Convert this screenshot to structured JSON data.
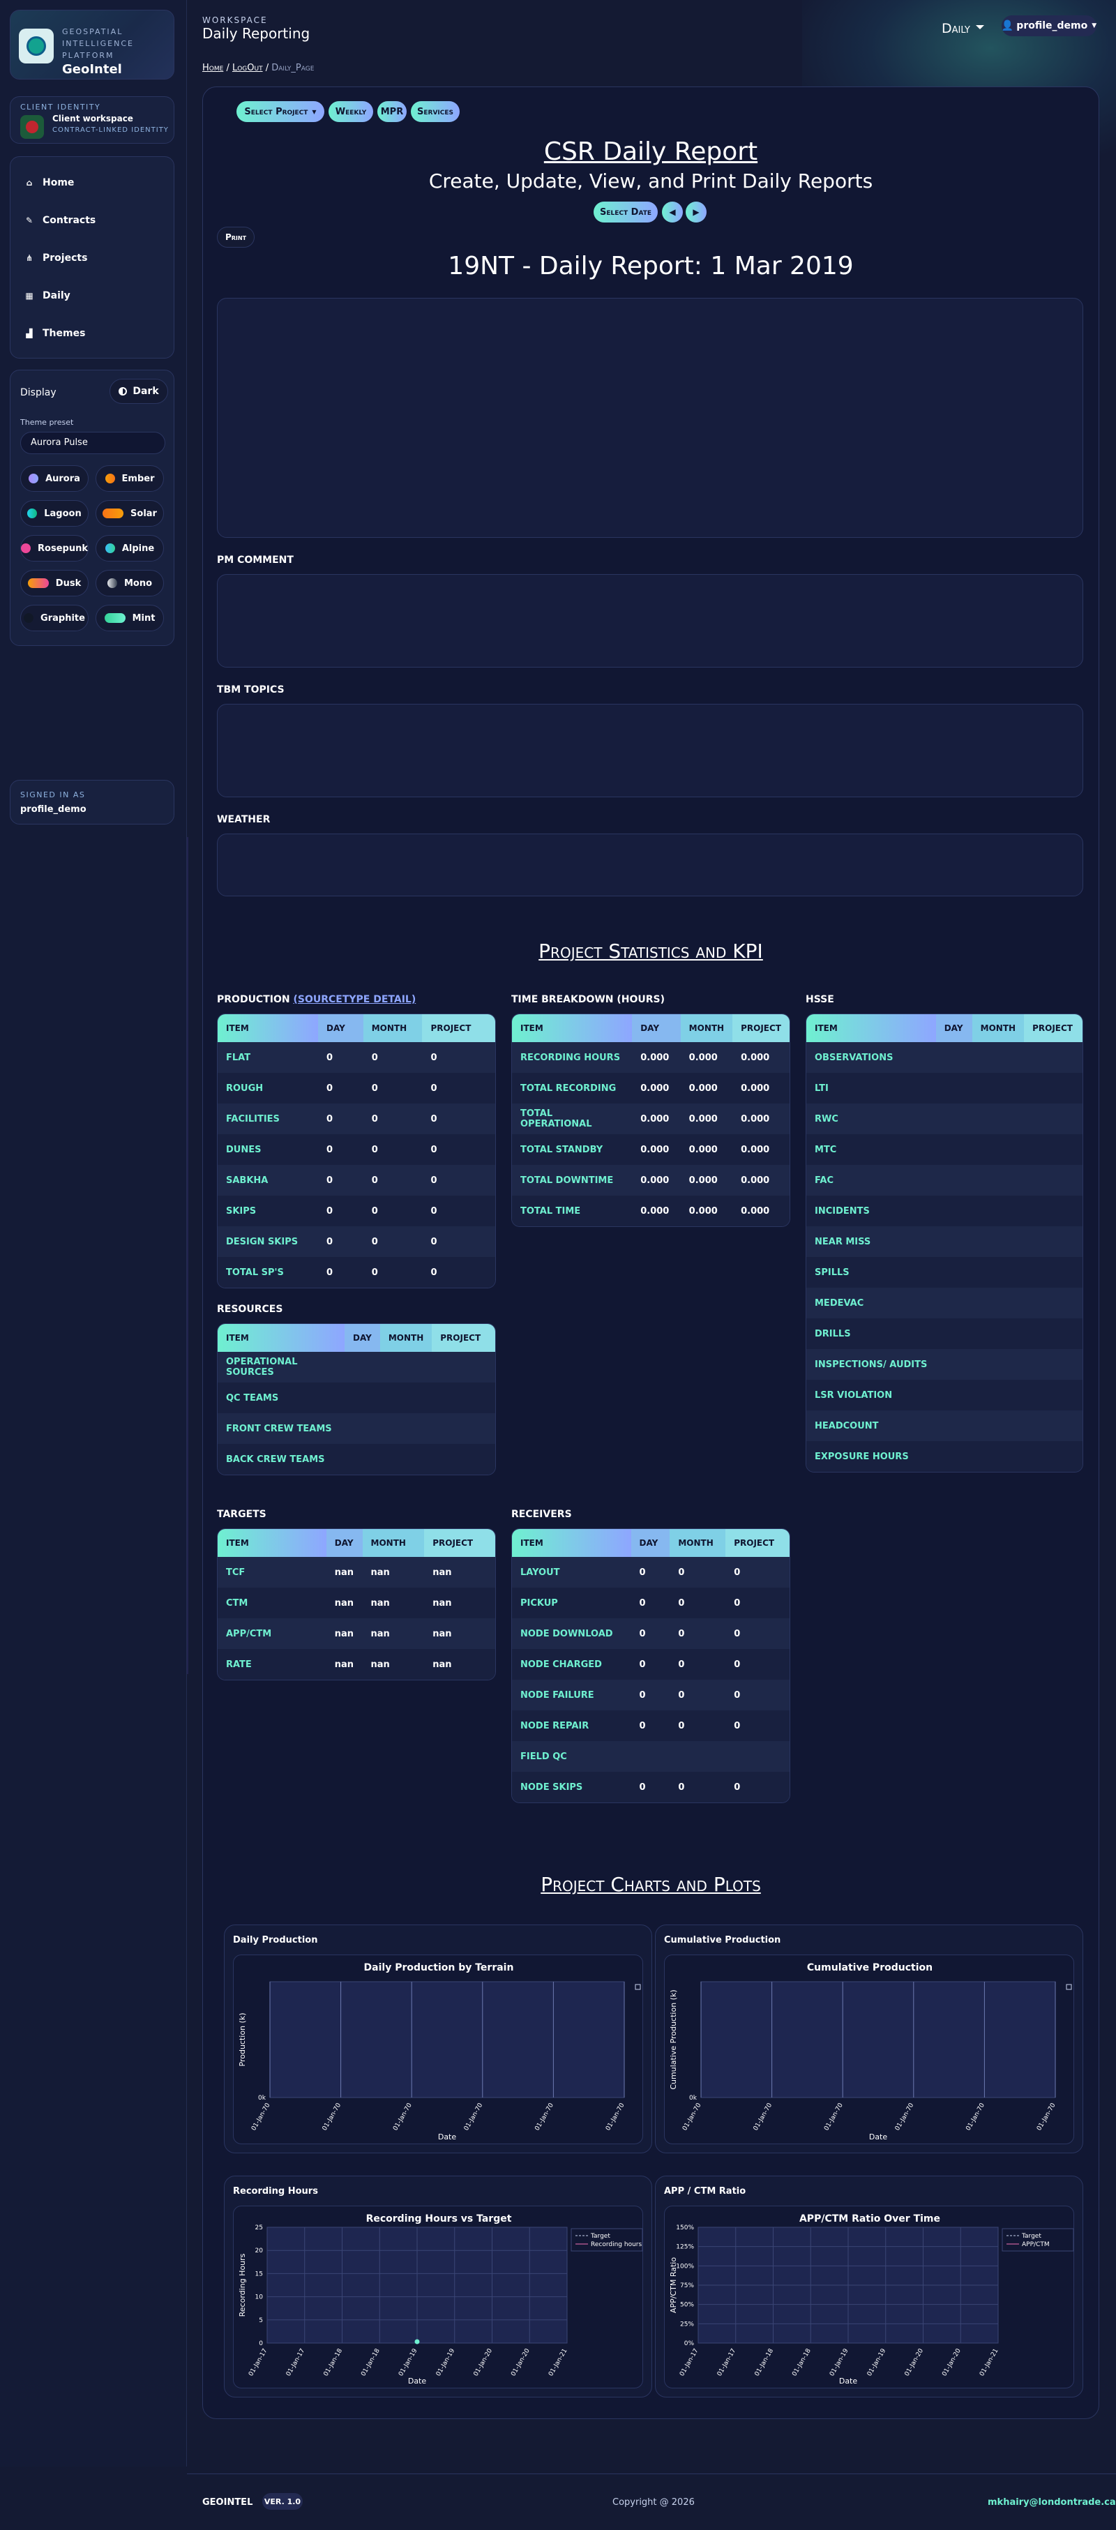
{
  "brand": {
    "subtitle": "Geospatial Intelligence Platform",
    "name": "GeoIntel"
  },
  "client": {
    "caption": "Client identity",
    "title": "Client workspace",
    "subtitle": "Contract-linked identity"
  },
  "nav": [
    {
      "label": "Home",
      "icon": "home-icon"
    },
    {
      "label": "Contracts",
      "icon": "signature-icon"
    },
    {
      "label": "Projects",
      "icon": "project-diagram-icon"
    },
    {
      "label": "Daily",
      "icon": "calendar-icon"
    },
    {
      "label": "Themes",
      "icon": "chart-icon"
    }
  ],
  "display": {
    "label": "Display",
    "mode": "Dark",
    "preset_label": "Theme preset",
    "preset_value": "Aurora Pulse",
    "themes": [
      {
        "name": "Aurora",
        "color": "#a78bfa",
        "color2": "#8ea6ff"
      },
      {
        "name": "Ember",
        "color": "#f59e0b",
        "color2": "#f97316"
      },
      {
        "name": "Lagoon",
        "color": "#22d3ee",
        "color2": "#10b981"
      },
      {
        "name": "Solar",
        "color": "#f97316",
        "color2": "#f59e0b"
      },
      {
        "name": "Rosepunk",
        "color": "#ec4899",
        "color2": "#ec4899"
      },
      {
        "name": "Alpine",
        "color": "#38bdf8",
        "color2": "#34d399"
      },
      {
        "name": "Dusk",
        "color": "#f59e0b",
        "color2": "#ec4899"
      },
      {
        "name": "Mono",
        "color": "#e5e7eb",
        "color2": "#374151"
      },
      {
        "name": "Graphite",
        "color": "#111827",
        "color2": "#111827"
      },
      {
        "name": "Mint",
        "color": "#34d399",
        "color2": "#6ff0d0"
      }
    ]
  },
  "signed": {
    "caption": "Signed in as",
    "user": "profile_demo"
  },
  "header": {
    "workspace": "Workspace",
    "title": "Daily Reporting",
    "mode": "Daily",
    "user": "profile_demo"
  },
  "breadcrumb": {
    "home": "Home",
    "logout": "LogOut",
    "current": "Daily_Page"
  },
  "actions": {
    "select_project": "Select Project",
    "weekly": "Weekly",
    "mpr": "MPR",
    "services": "Services"
  },
  "report": {
    "title": "CSR Daily Report",
    "subtitle": "Create, Update, View, and Print Daily Reports",
    "select_date": "Select Date",
    "print": "Print",
    "date_title": "19NT - Daily Report: 1 Mar 2019"
  },
  "fields": {
    "pm_comment": "PM COMMENT",
    "tbm_topics": "TBM TOPICS",
    "weather": "WEATHER"
  },
  "kpi": {
    "title": "Project Statistics and KPI",
    "headers": [
      "ITEM",
      "DAY",
      "MONTH",
      "PROJECT"
    ],
    "production": {
      "caption": "PRODUCTION",
      "link": "(SOURCETYPE DETAIL)",
      "rows": [
        [
          "FLAT",
          "0",
          "0",
          "0"
        ],
        [
          "ROUGH",
          "0",
          "0",
          "0"
        ],
        [
          "FACILITIES",
          "0",
          "0",
          "0"
        ],
        [
          "DUNES",
          "0",
          "0",
          "0"
        ],
        [
          "SABKHA",
          "0",
          "0",
          "0"
        ],
        [
          "SKIPS",
          "0",
          "0",
          "0"
        ],
        [
          "DESIGN SKIPS",
          "0",
          "0",
          "0"
        ],
        [
          "TOTAL SP'S",
          "0",
          "0",
          "0"
        ]
      ]
    },
    "time": {
      "caption": "TIME BREAKDOWN (HOURS)",
      "rows": [
        [
          "RECORDING HOURS",
          "0.000",
          "0.000",
          "0.000"
        ],
        [
          "TOTAL RECORDING",
          "0.000",
          "0.000",
          "0.000"
        ],
        [
          "TOTAL OPERATIONAL",
          "0.000",
          "0.000",
          "0.000"
        ],
        [
          "TOTAL STANDBY",
          "0.000",
          "0.000",
          "0.000"
        ],
        [
          "TOTAL DOWNTIME",
          "0.000",
          "0.000",
          "0.000"
        ],
        [
          "TOTAL TIME",
          "0.000",
          "0.000",
          "0.000"
        ]
      ]
    },
    "hsse": {
      "caption": "HSSE",
      "rows": [
        [
          "OBSERVATIONS",
          "",
          "",
          ""
        ],
        [
          "LTI",
          "",
          "",
          ""
        ],
        [
          "RWC",
          "",
          "",
          ""
        ],
        [
          "MTC",
          "",
          "",
          ""
        ],
        [
          "FAC",
          "",
          "",
          ""
        ],
        [
          "INCIDENTS",
          "",
          "",
          ""
        ],
        [
          "NEAR MISS",
          "",
          "",
          ""
        ],
        [
          "SPILLS",
          "",
          "",
          ""
        ],
        [
          "MEDEVAC",
          "",
          "",
          ""
        ],
        [
          "DRILLS",
          "",
          "",
          ""
        ],
        [
          "INSPECTIONS/ AUDITS",
          "",
          "",
          ""
        ],
        [
          "LSR VIOLATION",
          "",
          "",
          ""
        ],
        [
          "HEADCOUNT",
          "",
          "",
          ""
        ],
        [
          "EXPOSURE HOURS",
          "",
          "",
          ""
        ]
      ]
    },
    "resources": {
      "caption": "RESOURCES",
      "rows": [
        [
          "OPERATIONAL SOURCES",
          "",
          "",
          ""
        ],
        [
          "QC TEAMS",
          "",
          "",
          ""
        ],
        [
          "FRONT CREW TEAMS",
          "",
          "",
          ""
        ],
        [
          "BACK CREW TEAMS",
          "",
          "",
          ""
        ]
      ]
    },
    "targets": {
      "caption": "TARGETS",
      "rows": [
        [
          "TCF",
          "nan",
          "nan",
          "nan"
        ],
        [
          "CTM",
          "nan",
          "nan",
          "nan"
        ],
        [
          "APP/CTM",
          "nan",
          "nan",
          "nan"
        ],
        [
          "RATE",
          "nan",
          "nan",
          "nan"
        ]
      ]
    },
    "receivers": {
      "caption": "RECEIVERS",
      "rows": [
        [
          "LAYOUT",
          "0",
          "0",
          "0"
        ],
        [
          "PICKUP",
          "0",
          "0",
          "0"
        ],
        [
          "NODE DOWNLOAD",
          "0",
          "0",
          "0"
        ],
        [
          "NODE CHARGED",
          "0",
          "0",
          "0"
        ],
        [
          "NODE FAILURE",
          "0",
          "0",
          "0"
        ],
        [
          "NODE REPAIR",
          "0",
          "0",
          "0"
        ],
        [
          "FIELD QC",
          "",
          "",
          ""
        ],
        [
          "NODE SKIPS",
          "0",
          "0",
          "0"
        ]
      ]
    }
  },
  "charts_title": "Project Charts and Plots",
  "chart_data": [
    {
      "card": "Daily Production",
      "type": "bar",
      "title": "Daily Production by Terrain",
      "xlabel": "Date",
      "ylabel": "Production (k)",
      "x": [
        "01-Jan-70",
        "01-Jan-70",
        "01-Jan-70",
        "01-Jan-70",
        "01-Jan-70",
        "01-Jan-70"
      ],
      "y_ticks": [
        "0k"
      ],
      "series": []
    },
    {
      "card": "Cumulative Production",
      "type": "line",
      "title": "Cumulative Production",
      "xlabel": "Date",
      "ylabel": "Cumulative Production (k)",
      "x": [
        "01-Jan-70",
        "01-Jan-70",
        "01-Jan-70",
        "01-Jan-70",
        "01-Jan-70",
        "01-Jan-70"
      ],
      "y_ticks": [
        "0k"
      ],
      "series": []
    },
    {
      "card": "Recording Hours",
      "type": "line",
      "title": "Recording Hours vs Target",
      "xlabel": "Date",
      "ylabel": "Recording Hours",
      "x": [
        "01-Jan-17",
        "01-Jan-17",
        "01-Jan-18",
        "01-Jan-18",
        "01-Jan-19",
        "01-Jan-19",
        "01-Jan-20",
        "01-Jan-20",
        "01-Jan-21"
      ],
      "ylim": [
        0,
        25
      ],
      "y_ticks": [
        "0",
        "5",
        "10",
        "15",
        "20",
        "25"
      ],
      "series": [
        {
          "name": "Target",
          "values": []
        },
        {
          "name": "Recording hours",
          "values": [
            null,
            null,
            null,
            null,
            0,
            null,
            null,
            null,
            null
          ]
        }
      ]
    },
    {
      "card": "APP / CTM Ratio",
      "type": "line",
      "title": "APP/CTM Ratio Over Time",
      "xlabel": "Date",
      "ylabel": "APP/CTM Ratio",
      "x": [
        "01-Jan-17",
        "01-Jan-17",
        "01-Jan-18",
        "01-Jan-18",
        "01-Jan-19",
        "01-Jan-19",
        "01-Jan-20",
        "01-Jan-20",
        "01-Jan-21"
      ],
      "y_ticks": [
        "0%",
        "25%",
        "50%",
        "75%",
        "100%",
        "125%",
        "150%"
      ],
      "series": [
        {
          "name": "Target",
          "values": []
        },
        {
          "name": "APP/CTM",
          "values": []
        }
      ]
    }
  ],
  "footer": {
    "brand": "GEOINTEL",
    "version": "VER. 1.0",
    "copyright": "Copyright @ 2026",
    "email": "mkhairy@londontrade.ca"
  }
}
